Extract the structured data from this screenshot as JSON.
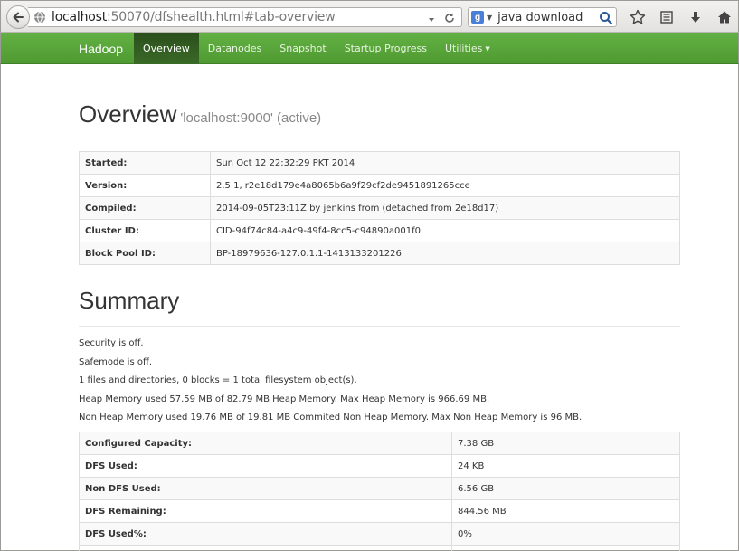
{
  "browser": {
    "url_host": "localhost",
    "url_rest": ":50070/dfshealth.html#tab-overview",
    "search_text": "java download"
  },
  "navbar": {
    "brand": "Hadoop",
    "items": [
      {
        "label": "Overview"
      },
      {
        "label": "Datanodes"
      },
      {
        "label": "Snapshot"
      },
      {
        "label": "Startup Progress"
      },
      {
        "label": "Utilities"
      }
    ]
  },
  "overview": {
    "title": "Overview",
    "subtitle": "'localhost:9000' (active)",
    "rows": [
      {
        "key": "Started:",
        "value": "Sun Oct 12 22:32:29 PKT 2014"
      },
      {
        "key": "Version:",
        "value": "2.5.1, r2e18d179e4a8065b6a9f29cf2de9451891265cce"
      },
      {
        "key": "Compiled:",
        "value": "2014-09-05T23:11Z by jenkins from (detached from 2e18d17)"
      },
      {
        "key": "Cluster ID:",
        "value": "CID-94f74c84-a4c9-49f4-8cc5-c94890a001f0"
      },
      {
        "key": "Block Pool ID:",
        "value": "BP-18979636-127.0.1.1-1413133201226"
      }
    ]
  },
  "summary": {
    "title": "Summary",
    "lines": [
      "Security is off.",
      "Safemode is off.",
      "1 files and directories, 0 blocks = 1 total filesystem object(s).",
      "Heap Memory used 57.59 MB of 82.79 MB Heap Memory. Max Heap Memory is 966.69 MB.",
      "Non Heap Memory used 19.76 MB of 19.81 MB Commited Non Heap Memory. Max Non Heap Memory is 96 MB."
    ],
    "rows": [
      {
        "key": "Configured Capacity:",
        "value": "7.38 GB"
      },
      {
        "key": "DFS Used:",
        "value": "24 KB"
      },
      {
        "key": "Non DFS Used:",
        "value": "6.56 GB"
      },
      {
        "key": "DFS Remaining:",
        "value": "844.56 MB"
      },
      {
        "key": "DFS Used%:",
        "value": "0%"
      },
      {
        "key": "",
        "value": ""
      }
    ]
  }
}
